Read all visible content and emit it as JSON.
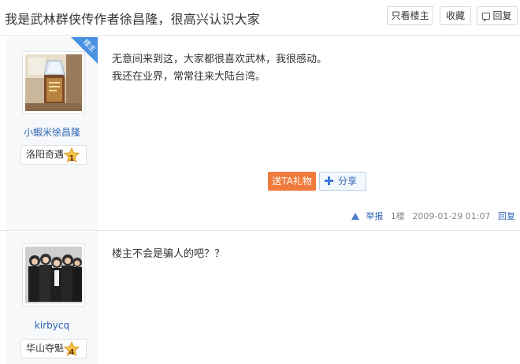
{
  "thread": {
    "title": "我是武林群侠传作者徐昌隆，很高兴认识大家"
  },
  "toolbar": {
    "only_op_label": "只看楼主",
    "favorite_label": "收藏",
    "reply_label": "回复"
  },
  "posts": [
    {
      "corner_tag": "楼主",
      "username": "小蝦米徐昌隆",
      "badge_name": "洛阳奇遇",
      "badge_level": "1",
      "content_lines": [
        "无意间来到这，大家都很喜欢武林，我很感动。",
        "我还在业界，常常往来大陆台湾。"
      ],
      "gift_label": "送TA礼物",
      "share_label": "分享",
      "report_label": "举报",
      "floor": "1楼",
      "timestamp": "2009-01-29 01:07",
      "reply_label": "回复"
    },
    {
      "username": "kirbycq",
      "badge_name": "华山夺魁",
      "badge_level": "4",
      "content_lines": [
        "楼主不会是骗人的吧？？"
      ]
    }
  ],
  "colors": {
    "link_blue": "#2d64b3",
    "gift_orange": "#f07a3b",
    "badge_gold": "#f3c04a",
    "corner_blue": "#4a90e2"
  }
}
